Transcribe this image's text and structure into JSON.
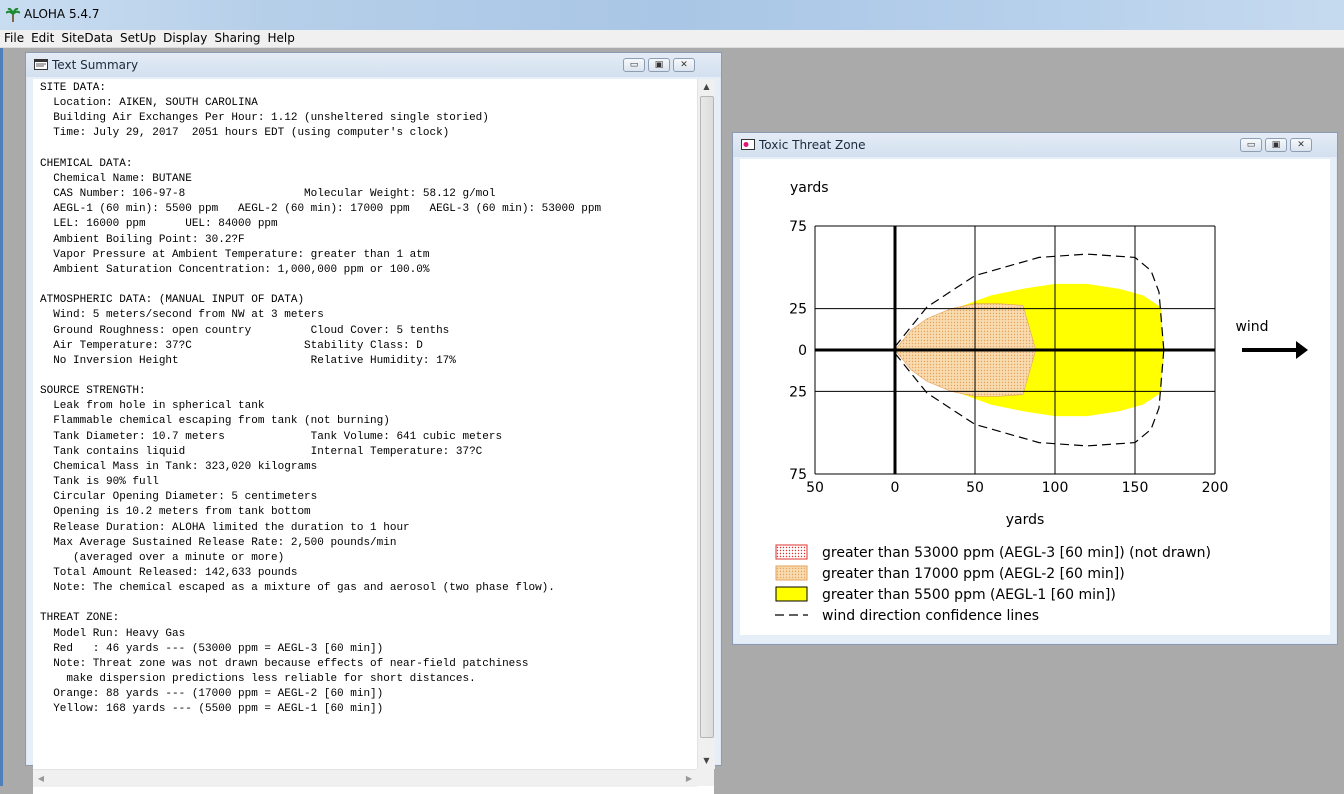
{
  "app": {
    "title": "ALOHA 5.4.7",
    "menu": [
      "File",
      "Edit",
      "SiteData",
      "SetUp",
      "Display",
      "Sharing",
      "Help"
    ]
  },
  "text_window": {
    "title": "Text Summary",
    "lines": [
      "SITE DATA:",
      "  Location: AIKEN, SOUTH CAROLINA",
      "  Building Air Exchanges Per Hour: 1.12 (unsheltered single storied)",
      "  Time: July 29, 2017  2051 hours EDT (using computer's clock)",
      "",
      "CHEMICAL DATA:",
      "  Chemical Name: BUTANE",
      "  CAS Number: 106-97-8                  Molecular Weight: 58.12 g/mol",
      "  AEGL-1 (60 min): 5500 ppm   AEGL-2 (60 min): 17000 ppm   AEGL-3 (60 min): 53000 ppm",
      "  LEL: 16000 ppm      UEL: 84000 ppm",
      "  Ambient Boiling Point: 30.2?F",
      "  Vapor Pressure at Ambient Temperature: greater than 1 atm",
      "  Ambient Saturation Concentration: 1,000,000 ppm or 100.0%",
      "",
      "ATMOSPHERIC DATA: (MANUAL INPUT OF DATA)",
      "  Wind: 5 meters/second from NW at 3 meters",
      "  Ground Roughness: open country         Cloud Cover: 5 tenths",
      "  Air Temperature: 37?C                 Stability Class: D",
      "  No Inversion Height                    Relative Humidity: 17%",
      "",
      "SOURCE STRENGTH:",
      "  Leak from hole in spherical tank",
      "  Flammable chemical escaping from tank (not burning)",
      "  Tank Diameter: 10.7 meters             Tank Volume: 641 cubic meters",
      "  Tank contains liquid                   Internal Temperature: 37?C",
      "  Chemical Mass in Tank: 323,020 kilograms",
      "  Tank is 90% full",
      "  Circular Opening Diameter: 5 centimeters",
      "  Opening is 10.2 meters from tank bottom",
      "  Release Duration: ALOHA limited the duration to 1 hour",
      "  Max Average Sustained Release Rate: 2,500 pounds/min",
      "     (averaged over a minute or more)",
      "  Total Amount Released: 142,633 pounds",
      "  Note: The chemical escaped as a mixture of gas and aerosol (two phase flow).",
      "",
      "THREAT ZONE:",
      "  Model Run: Heavy Gas",
      "  Red   : 46 yards --- (53000 ppm = AEGL-3 [60 min])",
      "  Note: Threat zone was not drawn because effects of near-field patchiness",
      "    make dispersion predictions less reliable for short distances.",
      "  Orange: 88 yards --- (17000 ppm = AEGL-2 [60 min])",
      "  Yellow: 168 yards --- (5500 ppm = AEGL-1 [60 min])"
    ]
  },
  "threat_window": {
    "title": "Toxic Threat Zone",
    "wind_label": "wind",
    "legend": [
      {
        "label": "greater than 53000 ppm (AEGL-3 [60 min]) (not drawn)",
        "swatch": "red-dots"
      },
      {
        "label": "greater than 17000 ppm (AEGL-2 [60 min])",
        "swatch": "orange-dots"
      },
      {
        "label": "greater than 5500 ppm (AEGL-1 [60 min])",
        "swatch": "yellow"
      },
      {
        "label": "wind direction confidence lines",
        "swatch": "dashed"
      }
    ]
  },
  "chart_data": {
    "type": "area",
    "xlabel": "yards",
    "ylabel": "yards",
    "xlim": [
      -50,
      200
    ],
    "ylim": [
      -75,
      75
    ],
    "x_ticks": [
      -50,
      0,
      50,
      100,
      150,
      200
    ],
    "x_tick_labels": [
      "50",
      "0",
      "50",
      "100",
      "150",
      "200"
    ],
    "y_ticks": [
      75,
      25,
      0,
      -25,
      -75
    ],
    "y_tick_labels": [
      "75",
      "25",
      "0",
      "25",
      "75"
    ],
    "grid": true,
    "colors": {
      "yellow": "#ffff00",
      "orange": "#f6d6a8",
      "orange_dot": "#e6a15c",
      "red_dot": "#e03030",
      "grid": "#000000"
    },
    "series": [
      {
        "name": "greater than 5500 ppm (AEGL-1 [60 min])",
        "max_extent_yards": 168,
        "x": [
          0,
          10,
          20,
          40,
          60,
          80,
          100,
          120,
          140,
          155,
          166,
          168
        ],
        "y_half_width": [
          0,
          9,
          16,
          26,
          33,
          37,
          40,
          40,
          37,
          33,
          26,
          0
        ]
      },
      {
        "name": "greater than 17000 ppm (AEGL-2 [60 min])",
        "max_extent_yards": 88,
        "x": [
          0,
          10,
          20,
          35,
          50,
          65,
          80,
          88
        ],
        "y_half_width": [
          0,
          12,
          19,
          25,
          28,
          28,
          27,
          0
        ]
      },
      {
        "name": "wind direction confidence lines",
        "x": [
          0,
          20,
          50,
          90,
          120,
          150,
          160,
          165,
          168
        ],
        "y_half_width": [
          2,
          26,
          45,
          56,
          58,
          56,
          48,
          35,
          0
        ]
      }
    ]
  }
}
